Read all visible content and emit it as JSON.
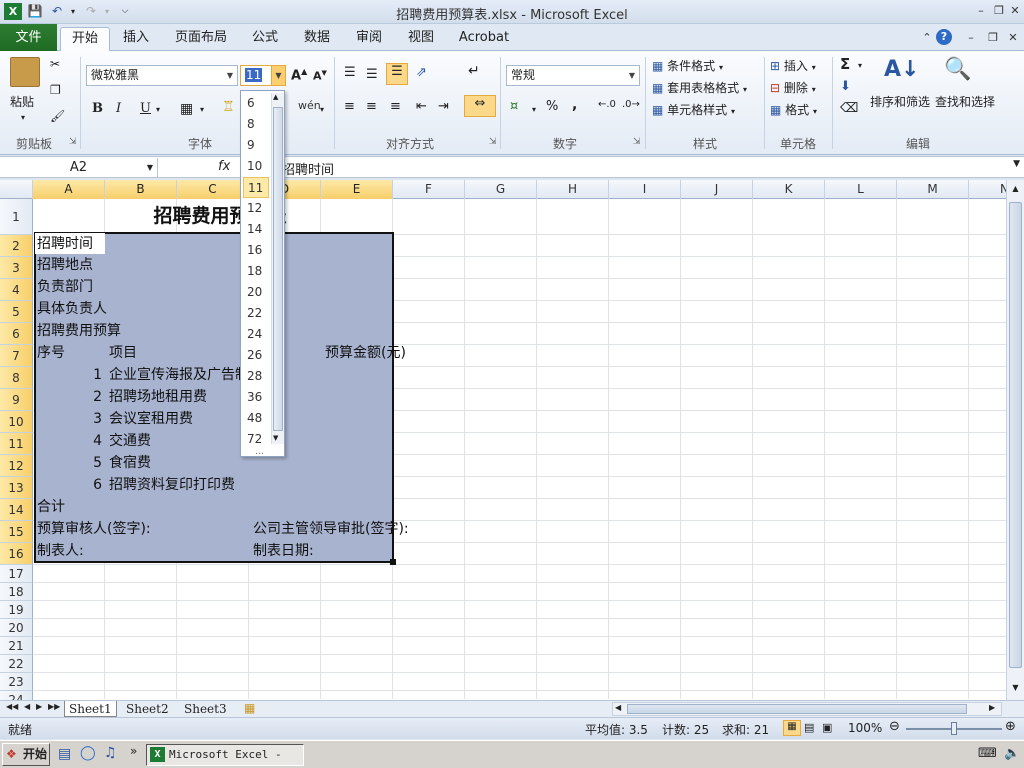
{
  "window": {
    "title": "招聘费用预算表.xlsx - Microsoft Excel"
  },
  "tabs": {
    "file": "文件",
    "home": "开始",
    "insert": "插入",
    "layout": "页面布局",
    "formula": "公式",
    "data": "数据",
    "review": "审阅",
    "view": "视图",
    "acrobat": "Acrobat"
  },
  "ribbon": {
    "clipboard": {
      "paste": "粘贴",
      "label": "剪贴板"
    },
    "font": {
      "name": "微软雅黑",
      "size": "11",
      "label": "字体",
      "bold": "B",
      "italic": "I",
      "underline": "U",
      "wen": "wén"
    },
    "align": {
      "label": "对齐方式"
    },
    "number": {
      "format": "常规",
      "label": "数字",
      "percent": "%",
      "comma": ","
    },
    "styles": {
      "cond": "条件格式",
      "table": "套用表格格式",
      "cell": "单元格样式",
      "label": "样式"
    },
    "cells": {
      "insert": "插入",
      "delete": "删除",
      "format": "格式",
      "label": "单元格"
    },
    "editing": {
      "sort": "排序和筛选",
      "find": "查找和选择",
      "label": "编辑",
      "sum": "Σ"
    }
  },
  "formula_bar": {
    "name_box": "A2",
    "fx": "fx",
    "value": "招聘时间"
  },
  "font_sizes": [
    "6",
    "8",
    "9",
    "10",
    "11",
    "12",
    "14",
    "16",
    "18",
    "20",
    "22",
    "24",
    "26",
    "28",
    "36",
    "48",
    "72"
  ],
  "selected_size": "11",
  "columns": [
    "A",
    "B",
    "C",
    "D",
    "E",
    "F",
    "G",
    "H",
    "I",
    "J",
    "K",
    "L",
    "M",
    "N"
  ],
  "rows": [
    "1",
    "2",
    "3",
    "4",
    "5",
    "6",
    "7",
    "8",
    "9",
    "10",
    "11",
    "12",
    "13",
    "14",
    "15",
    "16",
    "17",
    "18",
    "19",
    "20",
    "21",
    "22",
    "23",
    "24"
  ],
  "cells": {
    "title": "招聘费用预算表",
    "a2": "招聘时间",
    "a3": "招聘地点",
    "a4": "负责部门",
    "a5": "具体负责人",
    "a6": "招聘费用预算",
    "a7": "序号",
    "b7": "项目",
    "e7": "预算金额(元)",
    "n8": "1",
    "b8": "企业宣传海报及广告制作费",
    "n9": "2",
    "b9": "招聘场地租用费",
    "n10": "3",
    "b10": "会议室租用费",
    "n11": "4",
    "b11": "交通费",
    "n12": "5",
    "b12": "食宿费",
    "n13": "6",
    "b13": "招聘资料复印打印费",
    "a14": "合计",
    "a15": "预算审核人(签字):",
    "d15": "公司主管领导审批(签字):",
    "a16": "制表人:",
    "d16": "制表日期:"
  },
  "sheets": [
    "Sheet1",
    "Sheet2",
    "Sheet3"
  ],
  "status": {
    "ready": "就绪",
    "average": "平均值: 3.5",
    "count": "计数: 25",
    "sum": "求和: 21",
    "zoom": "100%"
  },
  "taskbar": {
    "start": "开始",
    "excel": "Microsoft Excel - ..."
  }
}
